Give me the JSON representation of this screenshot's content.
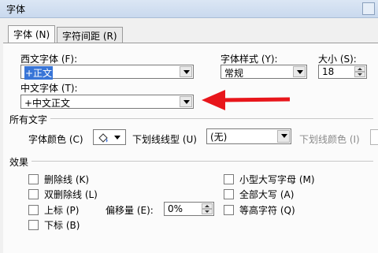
{
  "window": {
    "title": "字体"
  },
  "tabs": [
    {
      "label": "字体 (N)",
      "active": true
    },
    {
      "label": "字符间距 (R)",
      "active": false
    }
  ],
  "fonts": {
    "western_label": "西文字体 (F):",
    "western_value": "+正文",
    "chinese_label": "中文字体 (T):",
    "chinese_value": "+中文正文",
    "style_label": "字体样式 (Y):",
    "style_value": "常规",
    "size_label": "大小 (S):",
    "size_value": "18"
  },
  "all_text": {
    "section_label": "所有文字",
    "font_color_label": "字体颜色 (C)",
    "underline_type_label": "下划线线型 (U)",
    "underline_type_value": "(无)",
    "underline_color_label": "下划线颜色 (I)"
  },
  "effects": {
    "section_label": "效果",
    "left": [
      {
        "label": "删除线 (K)"
      },
      {
        "label": "双删除线 (L)"
      },
      {
        "label": "上标 (P)"
      },
      {
        "label": "下标 (B)"
      }
    ],
    "right": [
      {
        "label": "小型大写字母 (M)"
      },
      {
        "label": "全部大写 (A)"
      },
      {
        "label": "等高字符 (Q)"
      }
    ],
    "offset_label": "偏移量 (E):",
    "offset_value": "0%"
  },
  "colors": {
    "arrow": "#e8161b",
    "selection": "#3875d7"
  }
}
